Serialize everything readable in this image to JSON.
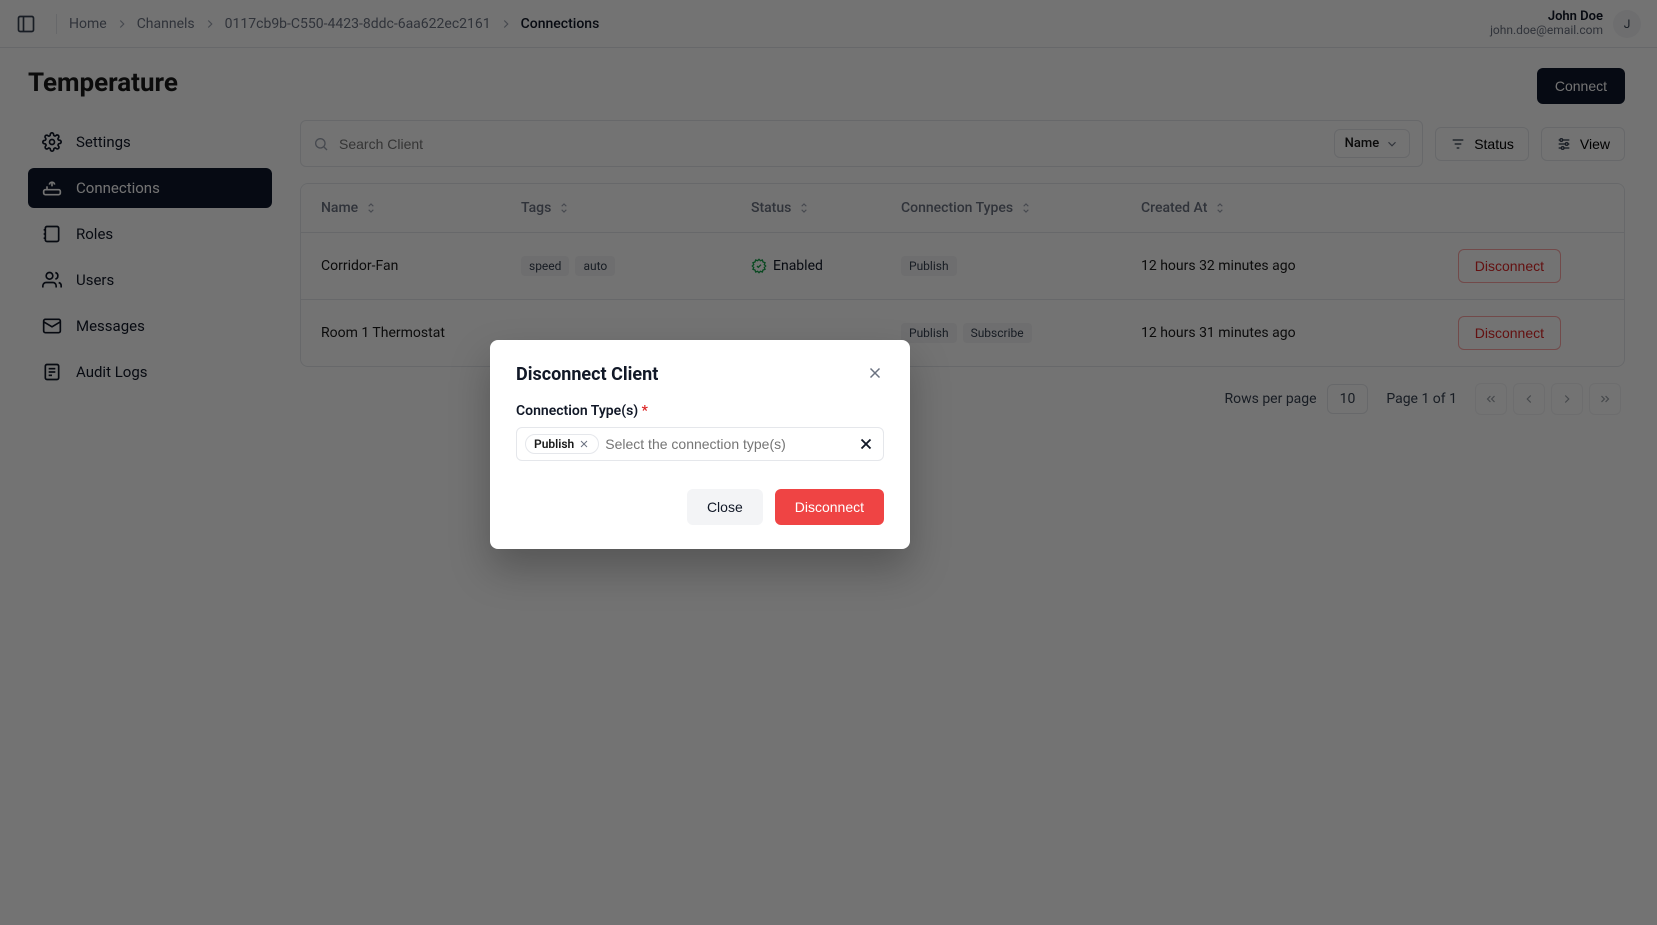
{
  "breadcrumb": {
    "home": "Home",
    "channels": "Channels",
    "channel_id": "0117cb9b-C550-4423-8ddc-6aa622ec2161",
    "current": "Connections"
  },
  "user": {
    "name": "John Doe",
    "email": "john.doe@email.com",
    "initial": "J"
  },
  "page_title": "Temperature",
  "sidebar": {
    "items": [
      {
        "label": "Settings"
      },
      {
        "label": "Connections"
      },
      {
        "label": "Roles"
      },
      {
        "label": "Users"
      },
      {
        "label": "Messages"
      },
      {
        "label": "Audit Logs"
      }
    ],
    "active_index": 1
  },
  "header": {
    "connect_button": "Connect"
  },
  "toolbar": {
    "search_placeholder": "Search Client",
    "search_field_label": "Name",
    "status_btn": "Status",
    "view_btn": "View"
  },
  "table": {
    "columns": {
      "name": "Name",
      "tags": "Tags",
      "status": "Status",
      "conn_types": "Connection Types",
      "created_at": "Created At"
    },
    "rows": [
      {
        "name": "Corridor-Fan",
        "tags": [
          "speed",
          "auto"
        ],
        "status": "Enabled",
        "conn_types": [
          "Publish"
        ],
        "created_at": "12 hours 32 minutes ago",
        "action": "Disconnect"
      },
      {
        "name": "Room 1 Thermostat",
        "tags": [],
        "status": "",
        "conn_types": [
          "Publish",
          "Subscribe"
        ],
        "created_at": "12 hours 31 minutes ago",
        "action": "Disconnect"
      }
    ]
  },
  "pagination": {
    "rows_per_page_label": "Rows per page",
    "rows_per_page_value": "10",
    "page_text": "Page 1 of 1"
  },
  "modal": {
    "title": "Disconnect Client",
    "field_label": "Connection Type(s)",
    "required_mark": "*",
    "selected_chip": "Publish",
    "placeholder": "Select the connection type(s)",
    "close_btn": "Close",
    "disconnect_btn": "Disconnect"
  }
}
